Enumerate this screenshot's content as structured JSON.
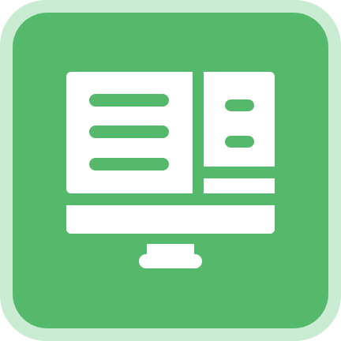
{
  "icon": {
    "name": "computer-monitor-icon",
    "depicts": "desktop-monitor-with-document-layout",
    "colors": {
      "outer_frame": "#c8ebd2",
      "background": "#55b96b",
      "foreground": "#ffffff",
      "accent_lines": "#55b96b"
    }
  }
}
